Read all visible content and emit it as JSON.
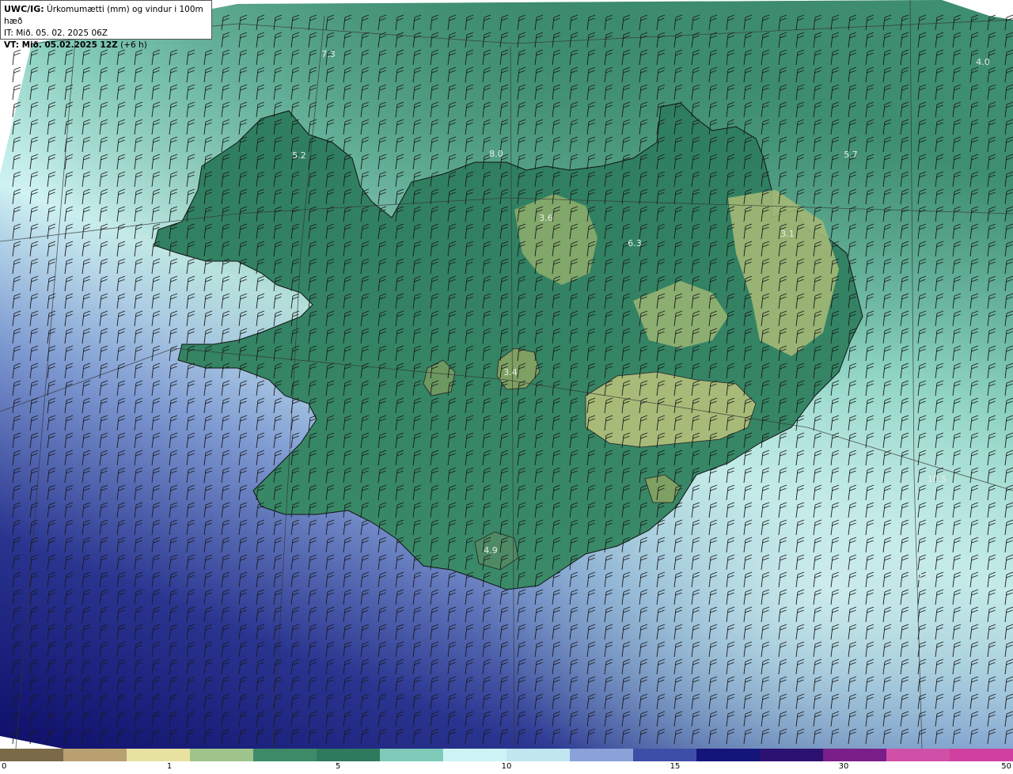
{
  "header": {
    "product": "UWC/IG:",
    "title": "Úrkomumætti (mm) og vindur i 100m hæð",
    "issue_time": "IT: Mið. 05. 02. 2025 06Z",
    "valid_prefix": "VT: Mið. 05.02.2025 12Z",
    "valid_offset": "(+6 h)"
  },
  "map_labels": [
    {
      "id": "label-7-3",
      "text": "7.3"
    },
    {
      "id": "label-4-0",
      "text": "4.0"
    },
    {
      "id": "label-5-2",
      "text": "5.2"
    },
    {
      "id": "label-8-0",
      "text": "8.0"
    },
    {
      "id": "label-5-7",
      "text": "5.7"
    },
    {
      "id": "label-3-6",
      "text": "3.6"
    },
    {
      "id": "label-6-3",
      "text": "6.3"
    },
    {
      "id": "label-3-1",
      "text": "3.1"
    },
    {
      "id": "label-3-4",
      "text": "3.4"
    },
    {
      "id": "label-4-9",
      "text": "4.9"
    },
    {
      "id": "label-10-5",
      "text": "10.5"
    },
    {
      "id": "label-7-5",
      "text": "7.5"
    }
  ],
  "colorbar": {
    "ticks": [
      "0",
      "1",
      "5",
      "10",
      "15",
      "30",
      "50"
    ],
    "colors": [
      "#7a6a48",
      "#b9a070",
      "#e8e2a0",
      "#9ec48c",
      "#3d8a68",
      "#2e7a5e",
      "#7fc9b8",
      "#cdf4f4",
      "#c0e6f0",
      "#8aa2d8",
      "#3d4ea8",
      "#14157a",
      "#2c1170",
      "#7a1e8a",
      "#d050a8",
      "#d040a0"
    ]
  },
  "colors": {
    "ocean_deep": "#14157a",
    "ocean_mid": "#6b83c8",
    "ocean_light": "#cdf0f0",
    "land_green": "#2e7a5e",
    "highland_olive": "#8aa868",
    "wind_barb": "#1a1a1a"
  }
}
